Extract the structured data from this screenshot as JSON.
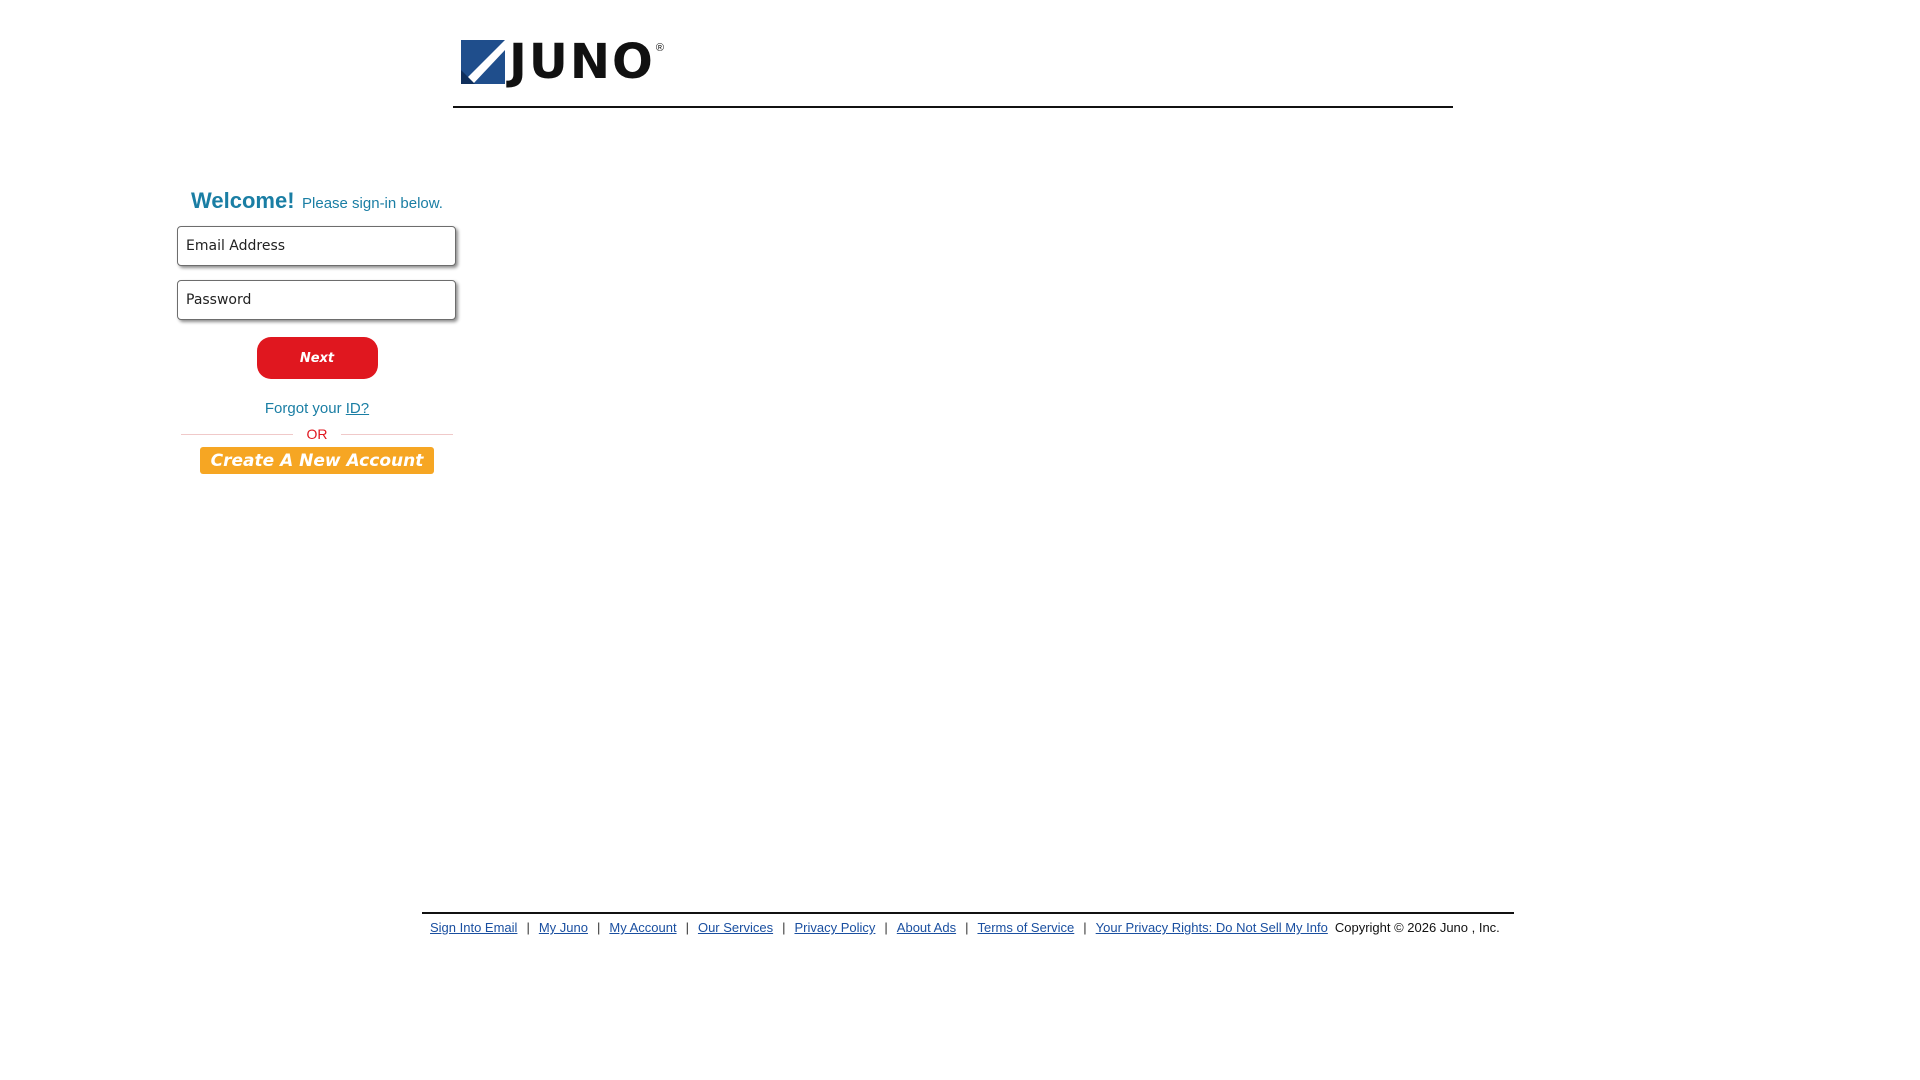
{
  "brand": {
    "logo_text": "JUNO",
    "reg_mark": "®",
    "colors": {
      "logo_blue": "#1f4e8c",
      "accent_teal": "#1a7ea4",
      "next_red": "#e0171f",
      "create_orange": "#f6a623",
      "link_blue": "#1a4fa0"
    }
  },
  "login": {
    "welcome": "Welcome!",
    "subtitle": "Please sign-in below.",
    "email_placeholder": "Email Address",
    "password_placeholder": "Password",
    "next_label": "Next",
    "forgot_prefix": "Forgot your",
    "forgot_link": "ID?",
    "or_label": "OR",
    "create_label": "Create A New Account"
  },
  "footer": {
    "separator": "|",
    "links": [
      "Sign Into Email",
      "My Juno",
      "My Account",
      "Our Services",
      "Privacy Policy",
      "About Ads",
      "Terms of Service",
      "Your Privacy Rights: Do Not Sell My Info"
    ],
    "copyright": "Copyright © 2026 Juno , Inc."
  }
}
